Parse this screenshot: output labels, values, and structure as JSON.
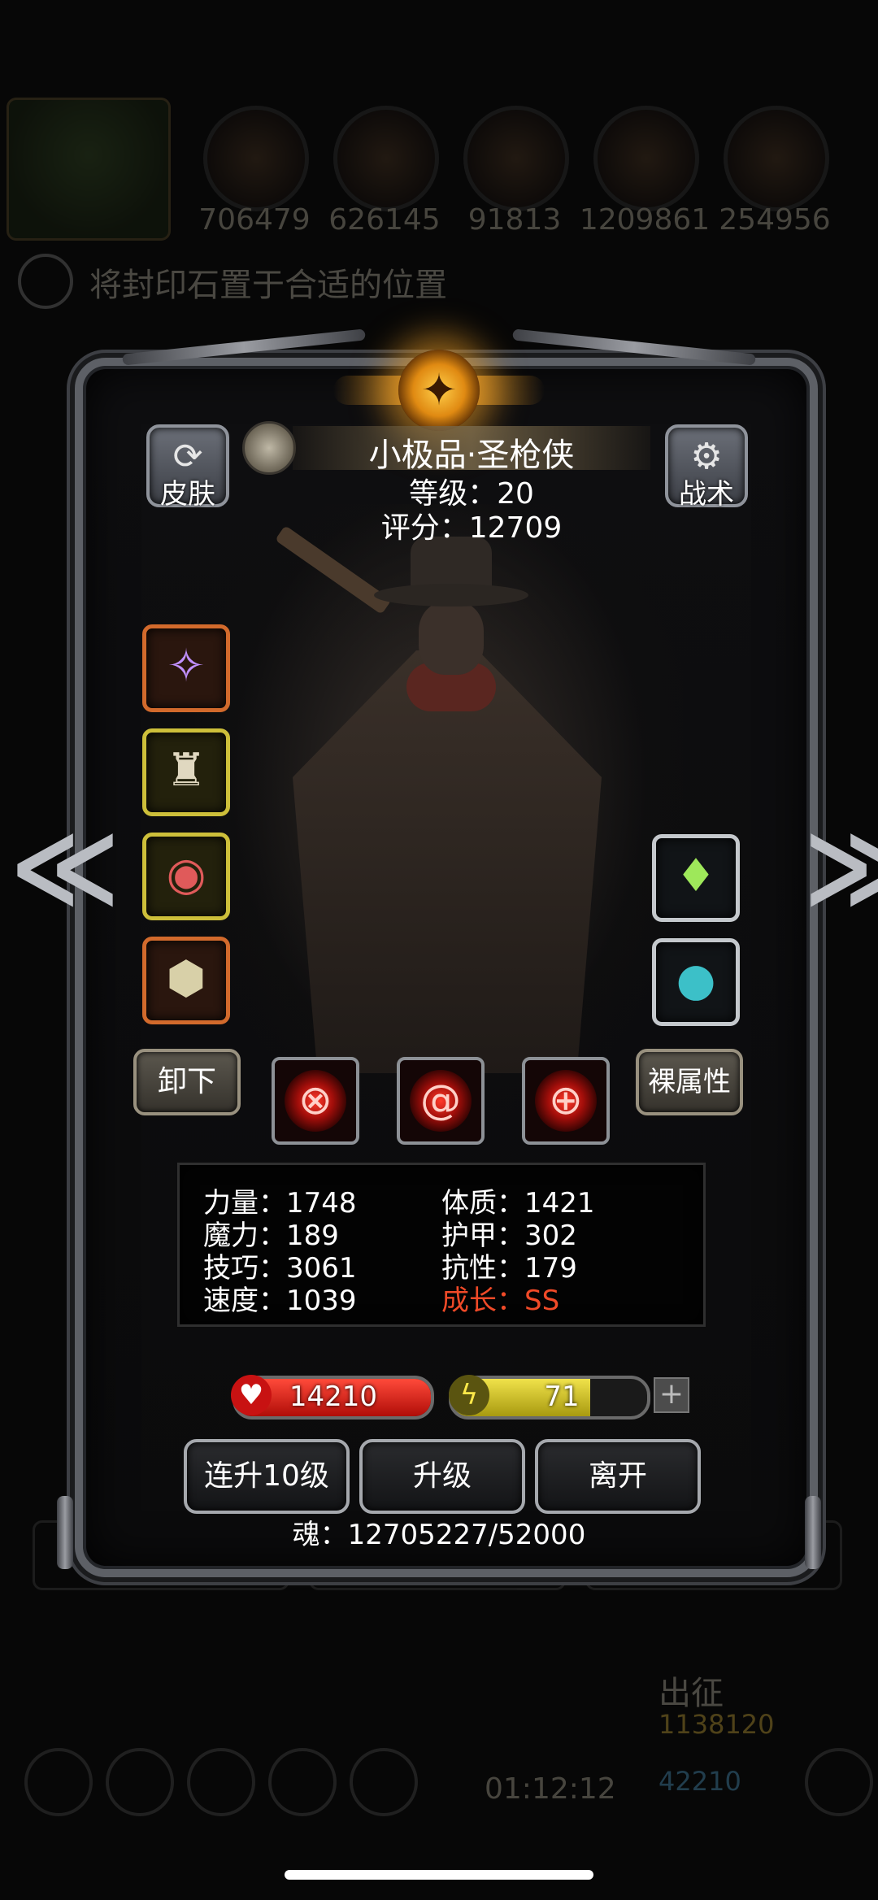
{
  "background": {
    "resources": [
      "706479",
      "626145",
      "91813",
      "1209861",
      "254956"
    ],
    "quest_text": "将封印石置于合适的位置",
    "march_label": "出征",
    "march_gold": "1138120",
    "march_gems": "42210",
    "timer": "01:12:12"
  },
  "dialog": {
    "skin_label": "皮肤",
    "tactics_label": "战术",
    "character_name": "小极品·圣枪侠",
    "level_text": "等级：20",
    "score_text": "评分：12709",
    "unequip_label": "卸下",
    "naked_attr_label": "裸属性",
    "stats": {
      "strength": "力量：1748",
      "magic": "魔力：189",
      "skill": "技巧：3061",
      "speed": "速度：1039",
      "constitution": "体质：1421",
      "armor": "护甲：302",
      "resistance": "抗性：179",
      "growth": "成长：SS"
    },
    "hp_value": "14210",
    "hp_fraction": 1.0,
    "energy_value": "71",
    "energy_fraction": 0.71,
    "plus_label": "+",
    "btn_level10": "连升10级",
    "btn_levelup": "升级",
    "btn_leave": "离开",
    "soul_text": "魂：12705227/52000"
  },
  "icons": {
    "left_arrow": "≪",
    "right_arrow": "≫",
    "skin_icon": "⟳",
    "tactics_icon": "⚙",
    "heart": "♥",
    "bolt": "ϟ"
  },
  "colors": {
    "growth": "#f04a28",
    "hp": "#d8160e",
    "energy": "#d6c626",
    "slot_orange": "#d26a2c",
    "slot_yellow": "#cdbf3a"
  }
}
